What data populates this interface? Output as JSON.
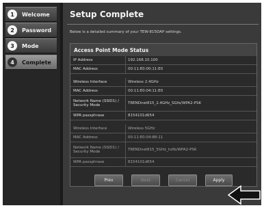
{
  "sidebar": {
    "items": [
      {
        "num": "1",
        "label": "Welcome",
        "active": false
      },
      {
        "num": "2",
        "label": "Password",
        "active": false
      },
      {
        "num": "3",
        "label": "Mode",
        "active": false
      },
      {
        "num": "4",
        "label": "Complete",
        "active": true
      }
    ]
  },
  "main": {
    "title": "Setup Complete",
    "intro": "Below is a detailed summary of your TEW-815DAP settings.",
    "panel_title": "Access Point Mode Status",
    "rows": [
      {
        "label": "IP Address",
        "value": "192.168.10.100"
      },
      {
        "label": "MAC Address",
        "value": "00:11:E0:00:11:E0"
      },
      {
        "label": "Wireless Interface",
        "value": "Wireless 2.4GHz"
      },
      {
        "label": "MAC Address",
        "value": "00:11:E0:04:11:E0"
      },
      {
        "label": "Network Name (SSID1) / Security Mode",
        "value": "TRENDnet815_2.4GHz_SGfe/WPA2-PSK"
      },
      {
        "label": "WPA passphrase",
        "value": "8154101d654"
      },
      {
        "label": "Wireless Interface",
        "value": "Wireless 5GHz"
      },
      {
        "label": "MAC Address",
        "value": "00:11:E0:04:88:11"
      },
      {
        "label": "Network Name (SSID1) / Security Mode",
        "value": "TRENDnet815_5GHz_hzfb/WPA2-PSK"
      },
      {
        "label": "WPA passphrase",
        "value": "8154101d654"
      }
    ]
  },
  "buttons": {
    "prev": "Prev",
    "next": "Next",
    "cancel": "Cancel",
    "apply": "Apply"
  }
}
